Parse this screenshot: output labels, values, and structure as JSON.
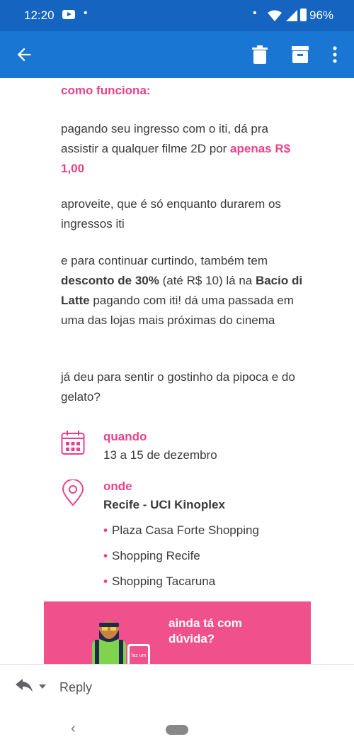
{
  "status_bar": {
    "time": "12:20",
    "battery_pct": "96%"
  },
  "app_bar": {
    "icons": [
      "back-arrow-icon",
      "trash-icon",
      "archive-icon",
      "more-vert-icon"
    ],
    "color": "#1976d2"
  },
  "email": {
    "section_title": "como funciona:",
    "para1": {
      "text": "pagando seu ingresso com o iti, dá pra assistir a qualquer filme 2D por ",
      "highlight": "apenas R$ 1,00"
    },
    "para2": "aproveite, que é só enquanto durarem os ingressos iti",
    "para3": {
      "pre": "e para continuar curtindo, também tem ",
      "bold1": "desconto de 30%",
      "mid": " (até R$ 10) lá na ",
      "bold2": "Bacio di Latte",
      "post": " pagando com iti! dá uma passada em uma das lojas mais próximas do cinema"
    },
    "para4": "já deu para sentir o gostinho da pipoca e do gelato?",
    "when": {
      "label": "quando",
      "value": "13 a 15 de dezembro"
    },
    "where": {
      "label": "onde",
      "value": "Recife - UCI Kinoplex",
      "locations": [
        "Plaza Casa Forte Shopping",
        "Shopping Recife",
        "Shopping Tacaruna"
      ]
    },
    "banner": {
      "title": "ainda tá com dúvida?",
      "phone_text": "faz um"
    },
    "accent_color": "#e8428b"
  },
  "reply_bar": {
    "label": "Reply"
  }
}
